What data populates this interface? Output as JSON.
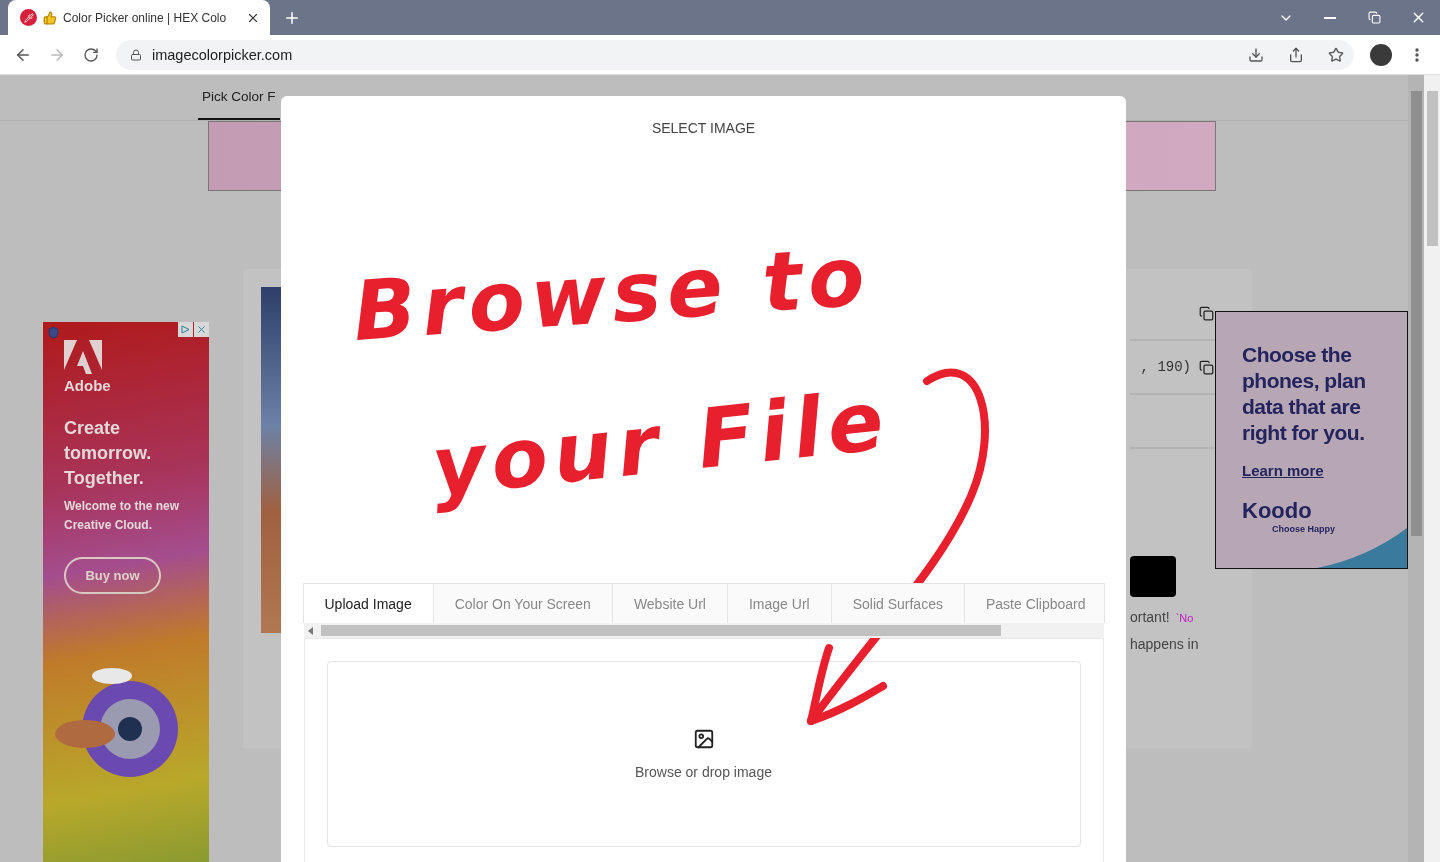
{
  "browser": {
    "tab_title": "Color Picker online | HEX Colo",
    "url": "imagecolorpicker.com"
  },
  "page": {
    "nav": [
      {
        "label": "Pick Color F",
        "selected": true
      }
    ],
    "left_ad": {
      "brand": "Adobe",
      "headline": "Create tomorrow. Together.",
      "subtext": "Welcome to the new Creative Cloud.",
      "button": "Buy now"
    },
    "right_ad": {
      "headline": "Choose the\nphones, plan\ndata that are\nright for you.",
      "link": "Learn more",
      "brand": "Koodo",
      "tagline": "Choose Happy"
    },
    "value_text": ", 190)",
    "note_lines": [
      {
        "text": "ortant!",
        "code": "`No"
      },
      {
        "text": "happens in"
      }
    ]
  },
  "modal": {
    "title": "SELECT IMAGE",
    "annotation": [
      "Browse to",
      "your File"
    ],
    "tabs": [
      {
        "label": "Upload Image",
        "selected": true
      },
      {
        "label": "Color On Your Screen",
        "selected": false
      },
      {
        "label": "Website Url",
        "selected": false
      },
      {
        "label": "Image Url",
        "selected": false
      },
      {
        "label": "Solid Surfaces",
        "selected": false
      },
      {
        "label": "Paste Clipboard",
        "selected": false
      }
    ],
    "dropzone": "Browse or drop image"
  }
}
